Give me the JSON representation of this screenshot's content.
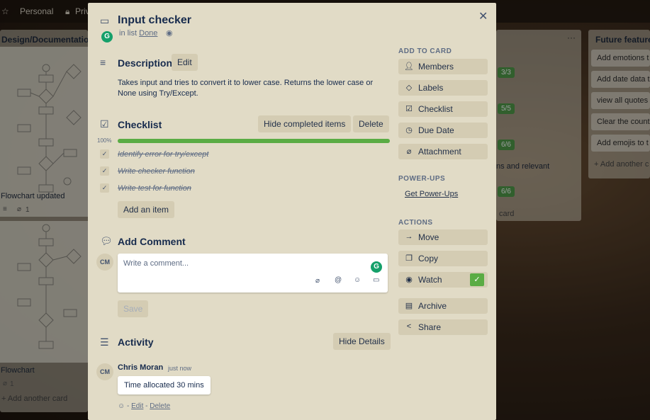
{
  "background": {
    "topbar": {
      "personal": "Personal",
      "private": "Priv"
    },
    "left_list": {
      "title": "Design/Documentation",
      "card1_label": "Flowchart updated",
      "card1_attach": "1",
      "card2_label": "Flowchart",
      "card2_attach": "1",
      "add_card": "+ Add another card"
    },
    "mid_list": {
      "badges": [
        "3/3",
        "5/5",
        "6/6",
        "6/6"
      ],
      "partial_text": "ns and relevant",
      "add_card": "card"
    },
    "right_list": {
      "title": "Future features",
      "cards": [
        "Add emotions t",
        "Add date data t",
        "view all quotes",
        "Clear the count",
        "Add emojis to t"
      ],
      "add_card": "+ Add another c"
    }
  },
  "card": {
    "title": "Input checker",
    "in_list_prefix": "in list",
    "list_name": "Done",
    "close_glyph": "✕"
  },
  "description": {
    "heading": "Description",
    "edit_label": "Edit",
    "text_line1": "Takes input and tries to convert it to lower case. Returns the lower case or",
    "text_line2": "None using Try/Except."
  },
  "checklist": {
    "heading": "Checklist",
    "hide_completed_label": "Hide completed items",
    "delete_label": "Delete",
    "progress_label": "100%",
    "progress": 1.0,
    "items": [
      "Identify error for try/except",
      "Write checker function",
      "Write test for function"
    ],
    "add_item_label": "Add an item"
  },
  "comment": {
    "heading": "Add Comment",
    "avatar_initials": "CM",
    "placeholder": "Write a comment...",
    "save_label": "Save"
  },
  "activity": {
    "heading": "Activity",
    "hide_details_label": "Hide Details",
    "avatar_initials": "CM",
    "author": "Chris Moran",
    "time": "just now",
    "comment_text": "Time allocated 30 mins",
    "separator": "-",
    "edit_label": "Edit",
    "delete_label": "Delete"
  },
  "sidebar": {
    "add_to_card_heading": "ADD TO CARD",
    "members": "Members",
    "labels": "Labels",
    "checklist": "Checklist",
    "due_date": "Due Date",
    "attachment": "Attachment",
    "power_ups_heading": "POWER-UPS",
    "get_power_ups": "Get Power-Ups",
    "actions_heading": "ACTIONS",
    "move": "Move",
    "copy": "Copy",
    "watch": "Watch",
    "archive": "Archive",
    "share": "Share"
  },
  "colors": {
    "accent_green": "#5aac44",
    "grammarly_green": "#15a06a",
    "modal_bg": "#e1dbc6",
    "button_bg": "#d4ccb3"
  }
}
